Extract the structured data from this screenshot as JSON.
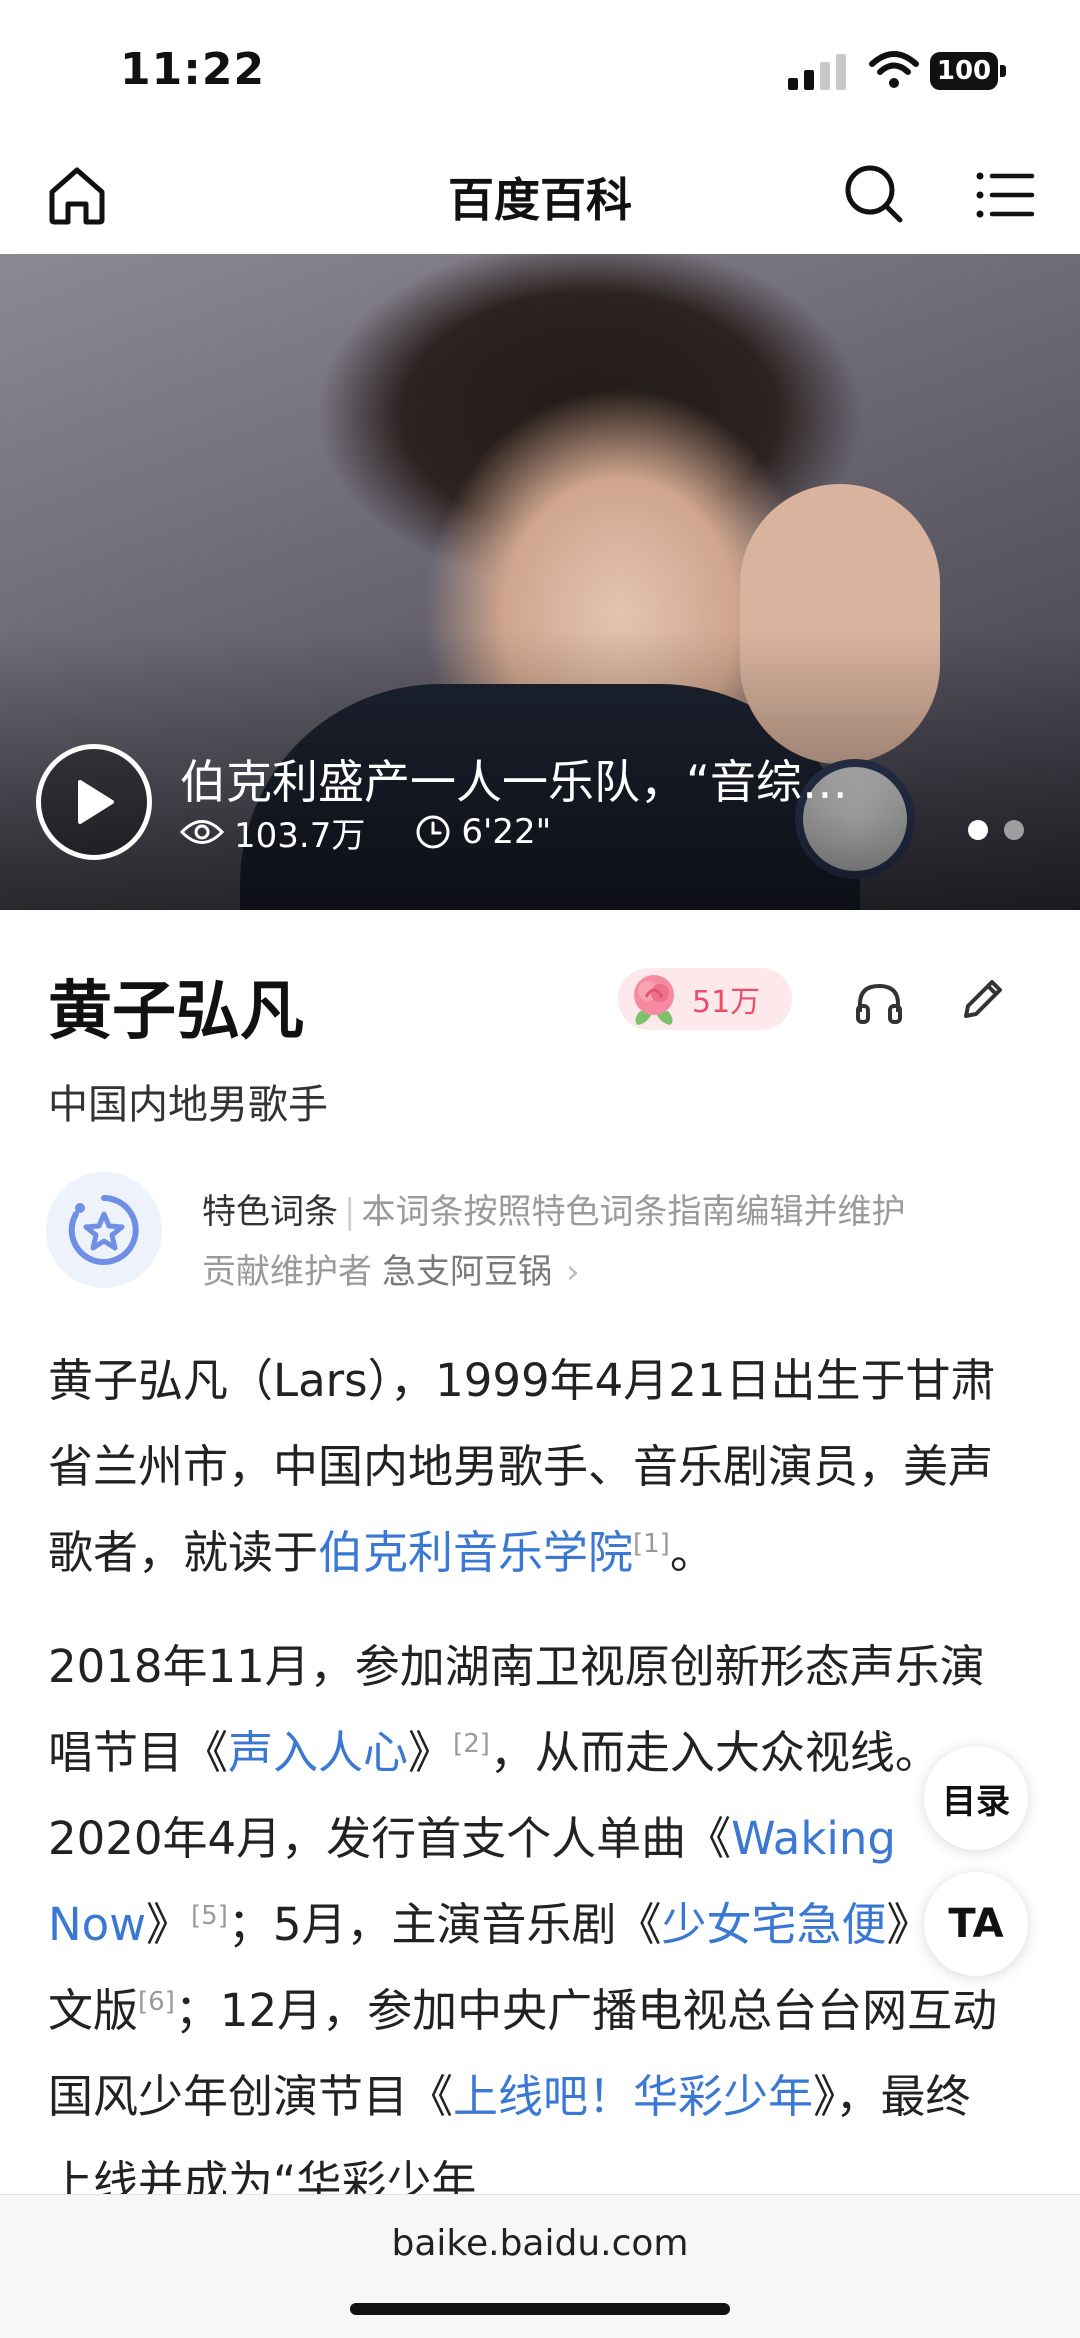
{
  "status_bar": {
    "time": "11:22",
    "battery": "100"
  },
  "nav": {
    "title": "百度百科"
  },
  "video": {
    "title": "伯克利盛产一人一乐队，“音综…",
    "views": "103.7万",
    "duration": "6'22\"",
    "slides_total": 2,
    "slide_active": 1
  },
  "entry": {
    "title": "黄子弘凡",
    "subtitle": "中国内地男歌手",
    "likes": "51万"
  },
  "featured": {
    "label": "特色词条",
    "separator": "|",
    "description": "本词条按照特色词条指南编辑并维护",
    "maintainer_label": "贡献维护者",
    "maintainer_name": "急支阿豆锅",
    "chevron": "›"
  },
  "para1": {
    "t1": "黄子弘凡（Lars），1999年4月21日出生于甘肃省兰州市，中国内地男歌手、音乐剧演员，美声歌者，就读于",
    "link1": "伯克利音乐学院",
    "ref1": "[1]",
    "t2": "。"
  },
  "para2": {
    "t1": "2018年11月，参加湖南卫视原创新形态声乐演唱节目《",
    "link1": "声入人心",
    "t2": "》",
    "ref1": "[2]",
    "t3": "，从而走入大众视线。2020年4月，发行首支个人单曲《",
    "link2": "Waking Now",
    "t4": "》",
    "ref2": "[5]",
    "t5": "；5月，主演音乐剧《",
    "link3": "少女宅急便",
    "t6": "》中文版",
    "ref3": "[6]",
    "t7": "；12月，参加中央广播电视总台台网互动国风少年创演节目《",
    "link4": "上线吧！华彩少年",
    "t8": "》，最终上线并成为“华彩少年"
  },
  "floating": {
    "toc": "目录",
    "ta": "TA"
  },
  "url_bar": {
    "url": "baike.baidu.com"
  },
  "colors": {
    "link": "#3a78d4",
    "like_bg": "#fde8ec",
    "like_text": "#e8506a"
  }
}
